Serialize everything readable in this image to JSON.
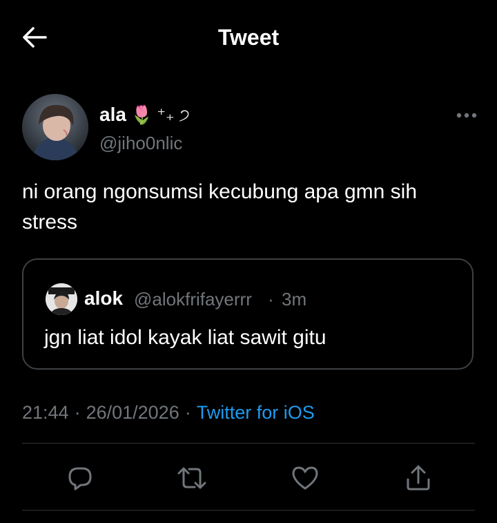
{
  "header": {
    "title": "Tweet",
    "back_icon": "arrow-left-icon"
  },
  "tweet": {
    "author": {
      "display_name": "ala",
      "name_emoji": "🌷",
      "name_decoration": "⁺₊ ੭",
      "handle": "@jiho0nlic",
      "avatar_icon": "avatar-photo"
    },
    "more_icon": "more-horizontal-icon",
    "text": "ni orang ngonsumsi kecubung apa gmn sih stress",
    "quoted": {
      "display_name": "alok",
      "handle": "@alokfrifayerrr",
      "separator": "·",
      "time": "3m",
      "text": "jgn liat idol kayak liat sawit gitu"
    },
    "meta": {
      "time": "21:44",
      "date": "26/01/2026",
      "separator": "·",
      "source": "Twitter for iOS"
    }
  },
  "actions": {
    "reply_icon": "reply-icon",
    "retweet_icon": "retweet-icon",
    "like_icon": "like-heart-icon",
    "share_icon": "share-icon"
  },
  "colors": {
    "background": "#000000",
    "text_primary": "#ffffff",
    "text_secondary": "#71767b",
    "accent": "#1d9bf0",
    "border": "#2f3336"
  }
}
